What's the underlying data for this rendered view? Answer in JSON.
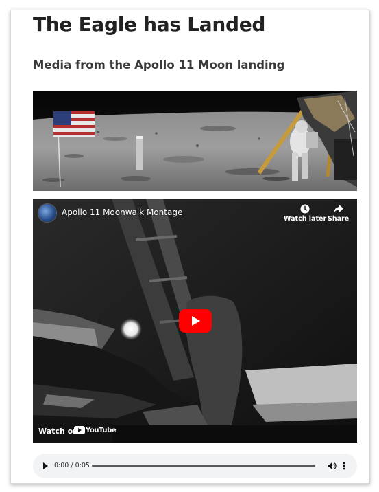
{
  "page": {
    "title": "The Eagle has Landed",
    "subtitle": "Media from the Apollo 11 Moon landing"
  },
  "video": {
    "title": "Apollo 11 Moonwalk Montage",
    "watch_later_label": "Watch later",
    "share_label": "Share",
    "watch_on_label": "Watch on",
    "youtube_label": "YouTube",
    "icons": [
      "channel-avatar-icon",
      "clock-icon",
      "share-arrow-icon",
      "play-icon",
      "youtube-logo-icon"
    ],
    "play_button_color": "#ff0000"
  },
  "audio": {
    "time_display": "0:00 / 0:05",
    "progress": 0,
    "icons": [
      "play-icon",
      "volume-icon",
      "more-options-icon"
    ]
  },
  "colors": {
    "heading": "#222222",
    "subheading": "#3a3a3a",
    "audio_bg": "#f1f3f4"
  }
}
